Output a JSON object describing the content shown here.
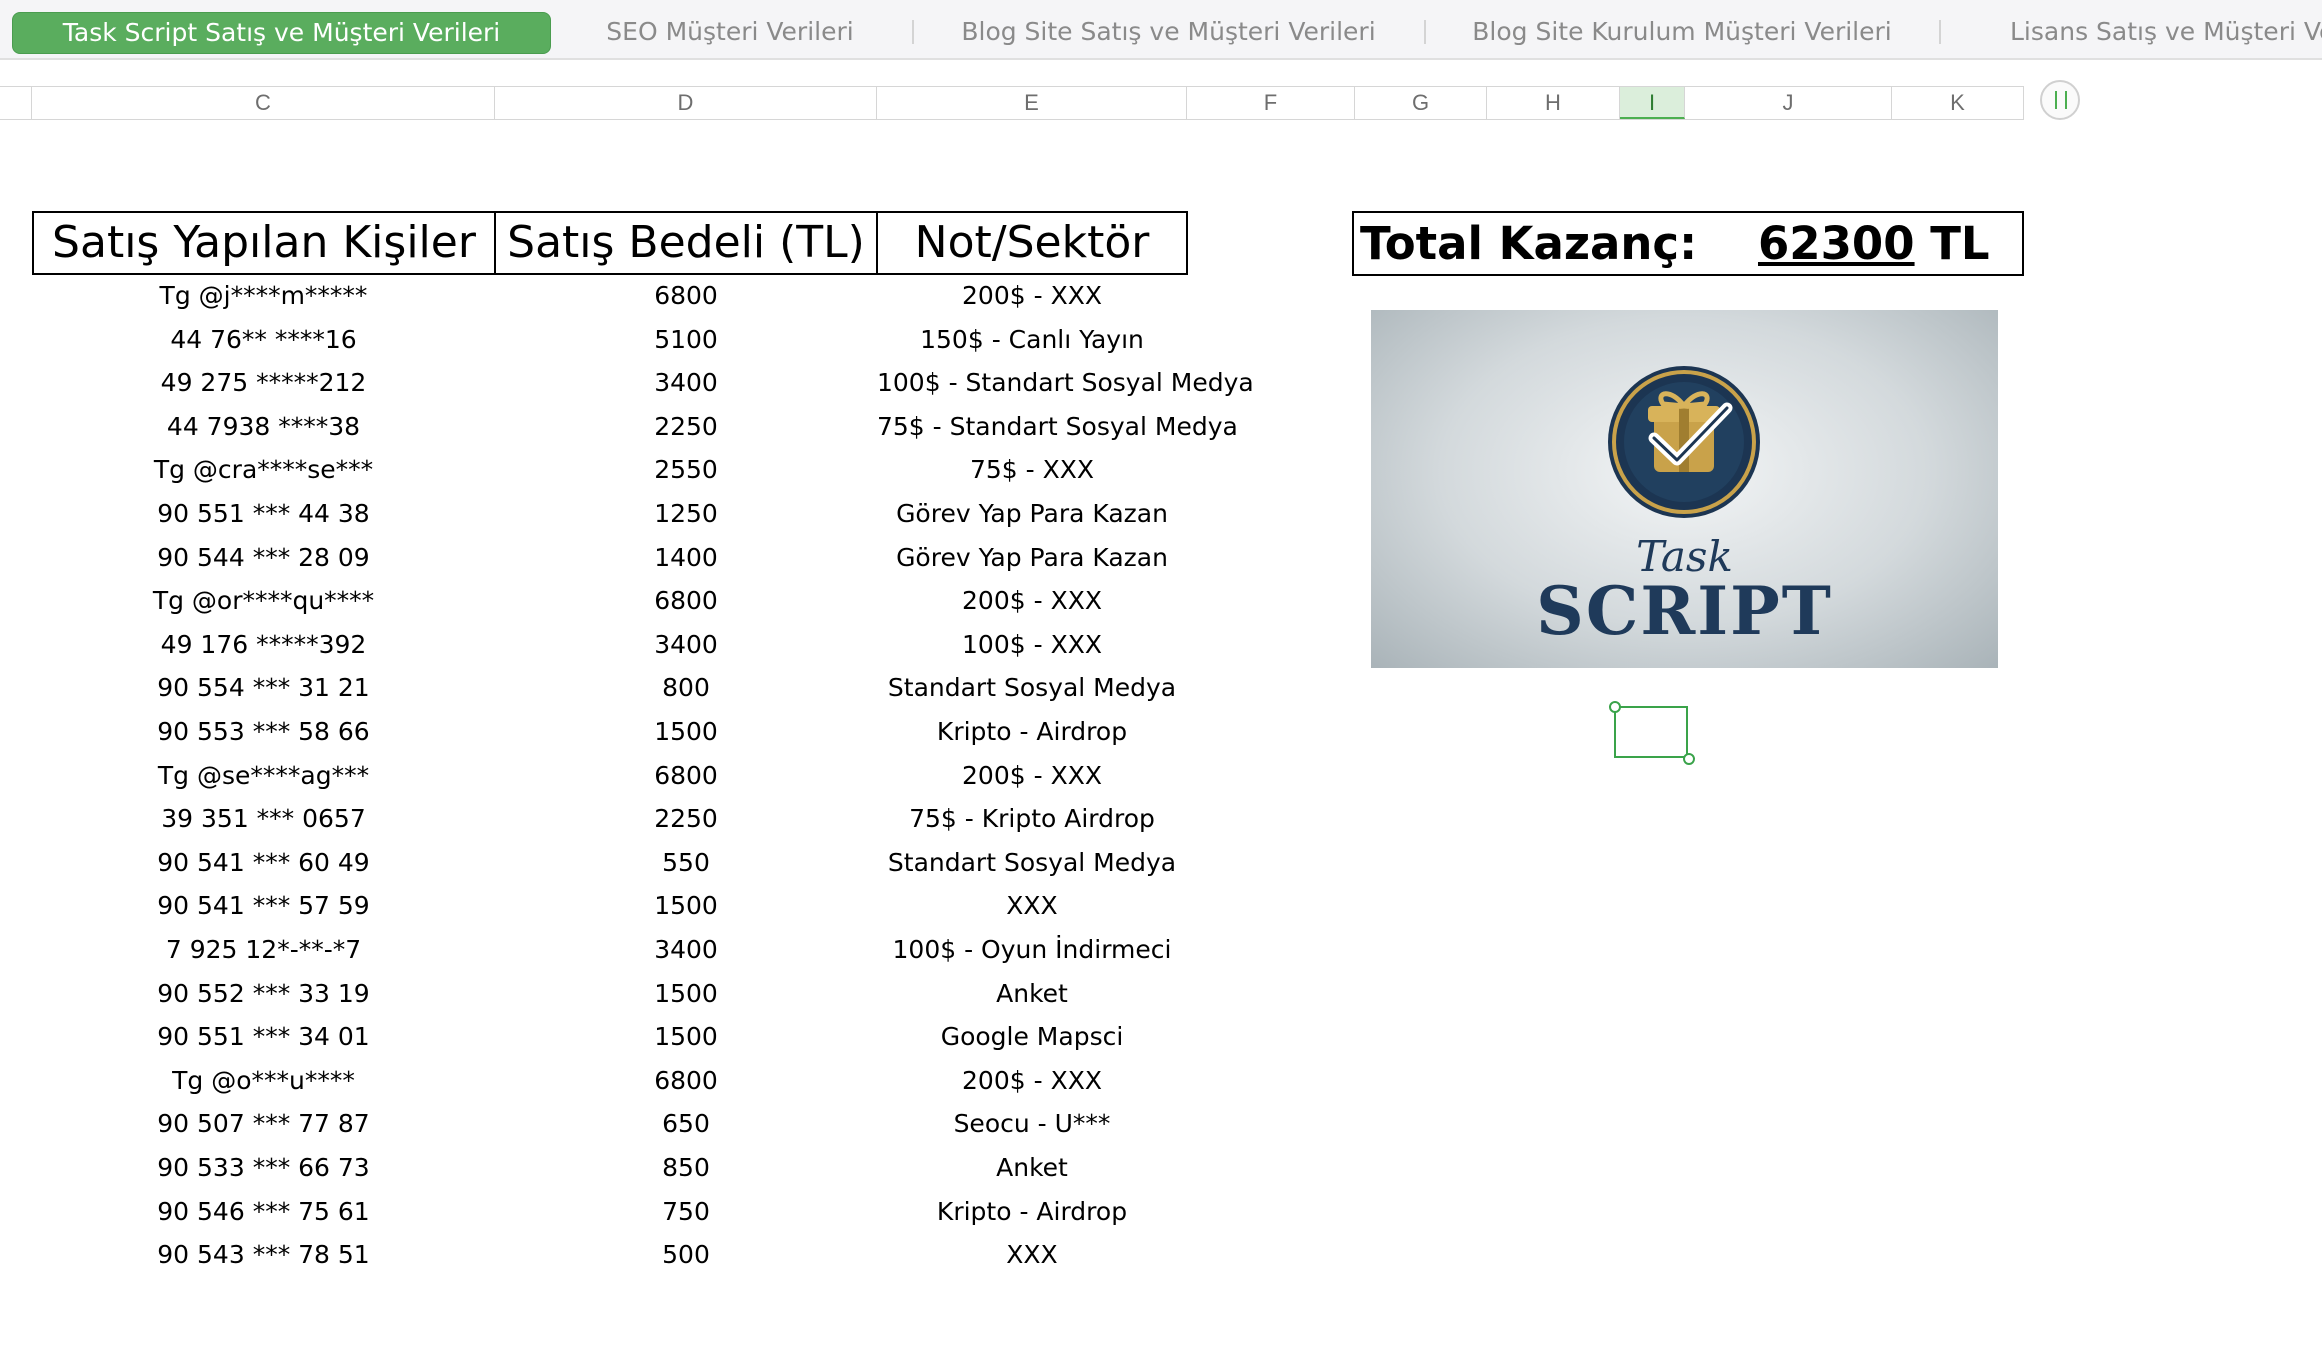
{
  "tabs": [
    {
      "label": "Task Script Satış ve Müşteri Verileri",
      "active": true
    },
    {
      "label": "SEO Müşteri Verileri",
      "active": false
    },
    {
      "label": "Blog Site Satış ve Müşteri Verileri",
      "active": false
    },
    {
      "label": "Blog Site Kurulum Müşteri Verileri",
      "active": false
    },
    {
      "label": "Lisans Satış ve Müşteri Ve",
      "active": false
    }
  ],
  "columns": [
    "C",
    "D",
    "E",
    "F",
    "G",
    "H",
    "I",
    "J",
    "K"
  ],
  "selected_column": "I",
  "table": {
    "headers": [
      "Satış Yapılan Kişiler",
      "Satış Bedeli (TL)",
      "Not/Sektör"
    ],
    "rows": [
      [
        "Tg @j****m*****",
        "6800",
        "200$ - XXX"
      ],
      [
        "44 76** ****16",
        "5100",
        "150$ - Canlı Yayın"
      ],
      [
        "49 275 *****212",
        "3400",
        "100$ - Standart Sosyal Medya"
      ],
      [
        "44 7938 ****38",
        "2250",
        "75$ - Standart Sosyal Medya"
      ],
      [
        "Tg @cra****se***",
        "2550",
        "75$ - XXX"
      ],
      [
        "90 551 *** 44 38",
        "1250",
        "Görev Yap Para Kazan"
      ],
      [
        "90 544 *** 28 09",
        "1400",
        "Görev Yap Para Kazan"
      ],
      [
        "Tg @or****qu****",
        "6800",
        "200$ - XXX"
      ],
      [
        "49 176 *****392",
        "3400",
        "100$ - XXX"
      ],
      [
        "90 554 *** 31 21",
        "800",
        "Standart Sosyal Medya"
      ],
      [
        "90 553 *** 58 66",
        "1500",
        "Kripto - Airdrop"
      ],
      [
        "Tg @se****ag***",
        "6800",
        "200$ - XXX"
      ],
      [
        "39 351 *** 0657",
        "2250",
        "75$ - Kripto Airdrop"
      ],
      [
        "90 541 *** 60 49",
        "550",
        "Standart Sosyal Medya"
      ],
      [
        "90 541 *** 57 59",
        "1500",
        "XXX"
      ],
      [
        "7 925 12*-**-*7",
        "3400",
        "100$ - Oyun İndirmeci"
      ],
      [
        "90 552 *** 33 19",
        "1500",
        "Anket"
      ],
      [
        "90 551 *** 34 01",
        "1500",
        "Google Mapsci"
      ],
      [
        "Tg @o***u****",
        "6800",
        "200$ - XXX"
      ],
      [
        "90 507 *** 77 87",
        "650",
        "Seocu - U***"
      ],
      [
        "90 533 *** 66 73",
        "850",
        "Anket"
      ],
      [
        "90 546 *** 75 61",
        "750",
        "Kripto - Airdrop"
      ],
      [
        "90 543 *** 78 51",
        "500",
        "XXX"
      ]
    ]
  },
  "total": {
    "label": "Total Kazanç:",
    "value": "62300",
    "unit": "TL"
  },
  "logo": {
    "line1": "Task",
    "line2": "SCRIPT",
    "icon": "gift-check-icon"
  },
  "colors": {
    "tab_active": "#5aad5e",
    "selection": "#3aa34a",
    "logo_navy": "#1f3a5a",
    "logo_gold": "#c9a24a"
  }
}
